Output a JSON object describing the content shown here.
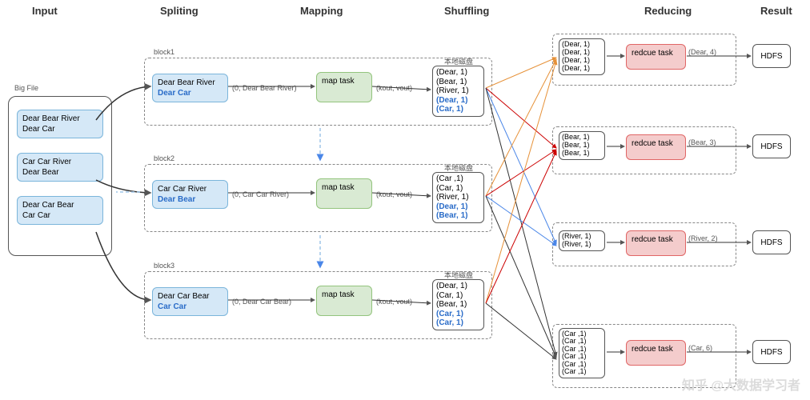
{
  "stages": {
    "input": "Input",
    "splitting": "Spliting",
    "mapping": "Mapping",
    "shuffling": "Shuffling",
    "reducing": "Reducing",
    "result": "Result"
  },
  "input": {
    "label": "Big File",
    "rec1": "Dear Bear River\nDear Car",
    "rec2": "Car Car River\nDear Bear",
    "rec3": "Dear Car Bear\nCar Car"
  },
  "block1": {
    "label": "block1",
    "data_top": "Dear Bear River",
    "data_bottom": "Dear Car",
    "kv": "(0, Dear Bear River)",
    "map": "map task",
    "kvout": "(kout, vout)",
    "disk_label": "本地磁盘",
    "disk_lines": [
      "(Dear, 1)",
      "(Bear, 1)",
      "(River, 1)"
    ],
    "disk_blue": [
      "(Dear, 1)",
      "(Car, 1)"
    ]
  },
  "block2": {
    "label": "block2",
    "data_top": "Car Car River",
    "data_bottom": "Dear Bear",
    "kv": "(0, Car Car River)",
    "map": "map task",
    "kvout": "(kout, vout)",
    "disk_label": "本地磁盘",
    "disk_lines": [
      "(Car ,1)",
      "(Car, 1)",
      "(River, 1)"
    ],
    "disk_blue": [
      "(Dear, 1)",
      "(Bear, 1)"
    ]
  },
  "block3": {
    "label": "block3",
    "data_top": "Dear Car Bear",
    "data_bottom": "Car Car",
    "kv": "(0, Dear Car Bear)",
    "map": "map task",
    "kvout": "(kout, vout)",
    "disk_label": "本地磁盘",
    "disk_lines": [
      "(Dear, 1)",
      "(Car, 1)",
      "(Bear, 1)"
    ],
    "disk_blue": [
      "(Car, 1)",
      "(Car, 1)"
    ]
  },
  "reduce1": {
    "shuffle": [
      "(Dear, 1)",
      "(Dear, 1)",
      "(Dear, 1)",
      "(Dear, 1)"
    ],
    "task": "redcue task",
    "out": "(Dear, 4)",
    "sink": "HDFS"
  },
  "reduce2": {
    "shuffle": [
      "(Bear, 1)",
      "(Bear, 1)",
      "(Bear, 1)"
    ],
    "task": "redcue task",
    "out": "(Bear, 3)",
    "sink": "HDFS"
  },
  "reduce3": {
    "shuffle": [
      "(River, 1)",
      "(River, 1)"
    ],
    "task": "redcue task",
    "out": "(River, 2)",
    "sink": "HDFS"
  },
  "reduce4": {
    "shuffle": [
      "(Car ,1)",
      "(Car ,1)",
      "(Car ,1)",
      "(Car ,1)",
      "(Car ,1)",
      "(Car ,1)"
    ],
    "task": "redcue task",
    "out": "(Car, 6)",
    "sink": "HDFS"
  },
  "watermark": "知乎 @大数据学习者"
}
